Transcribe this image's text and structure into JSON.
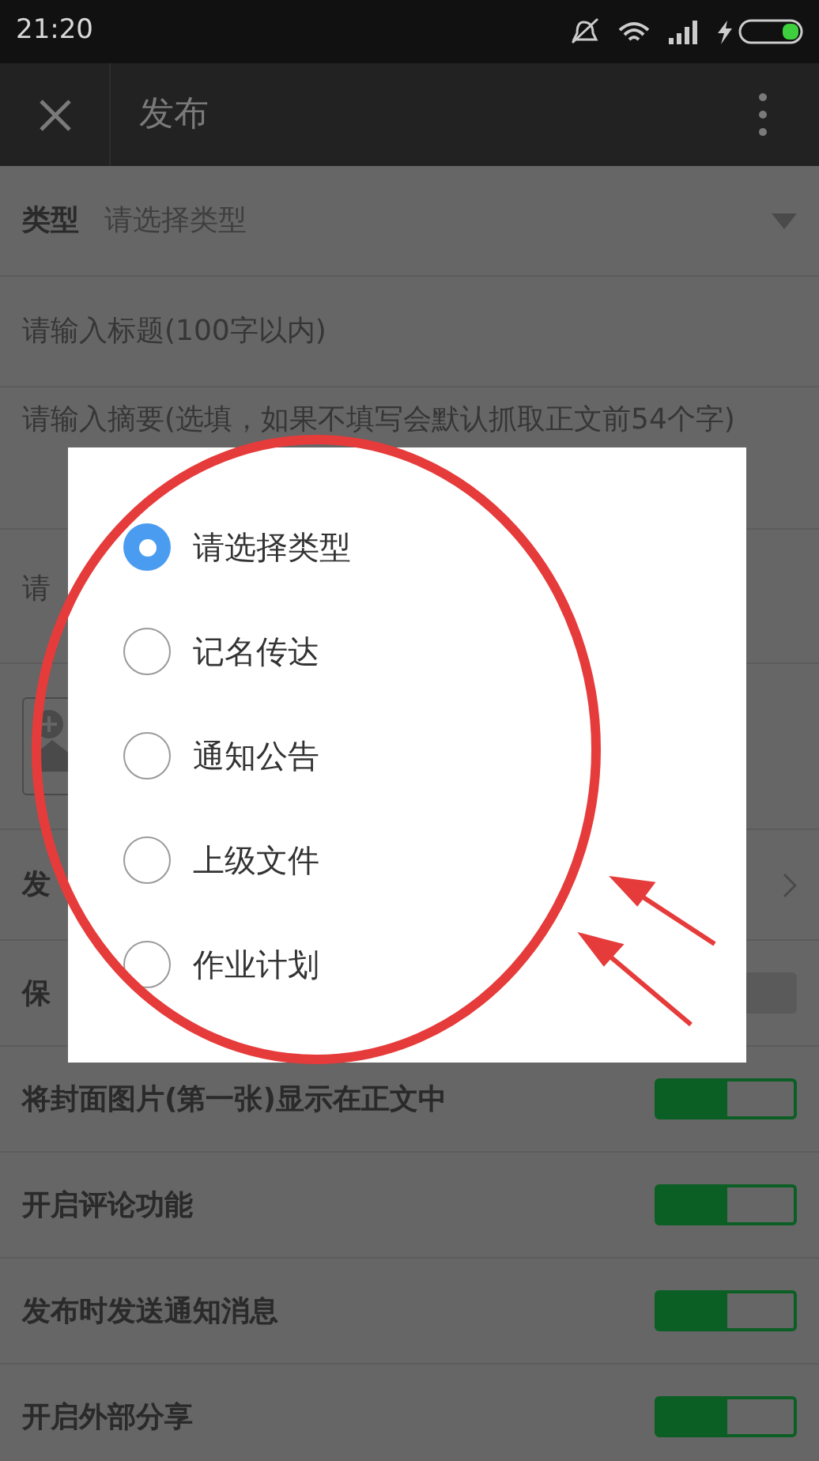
{
  "status_bar": {
    "time": "21:20"
  },
  "app_bar": {
    "title": "发布"
  },
  "form": {
    "type_row": {
      "label": "类型",
      "placeholder": "请选择类型"
    },
    "title_field": {
      "placeholder": "请输入标题(100字以内)"
    },
    "summary_field": {
      "placeholder": "请输入摘要(选填，如果不填写会默认抓取正文前54个字)"
    },
    "content_field": {
      "placeholder": "请"
    },
    "publish_row": {
      "label": "发"
    },
    "switches": [
      {
        "label": "保",
        "on": false
      },
      {
        "label": "将封面图片(第一张)显示在正文中",
        "on": true
      },
      {
        "label": "开启评论功能",
        "on": true
      },
      {
        "label": "发布时发送通知消息",
        "on": true
      },
      {
        "label": "开启外部分享",
        "on": true
      }
    ]
  },
  "dialog": {
    "options": [
      {
        "label": "请选择类型",
        "selected": true
      },
      {
        "label": "记名传达",
        "selected": false
      },
      {
        "label": "通知公告",
        "selected": false
      },
      {
        "label": "上级文件",
        "selected": false
      },
      {
        "label": "作业计划",
        "selected": false
      }
    ]
  }
}
